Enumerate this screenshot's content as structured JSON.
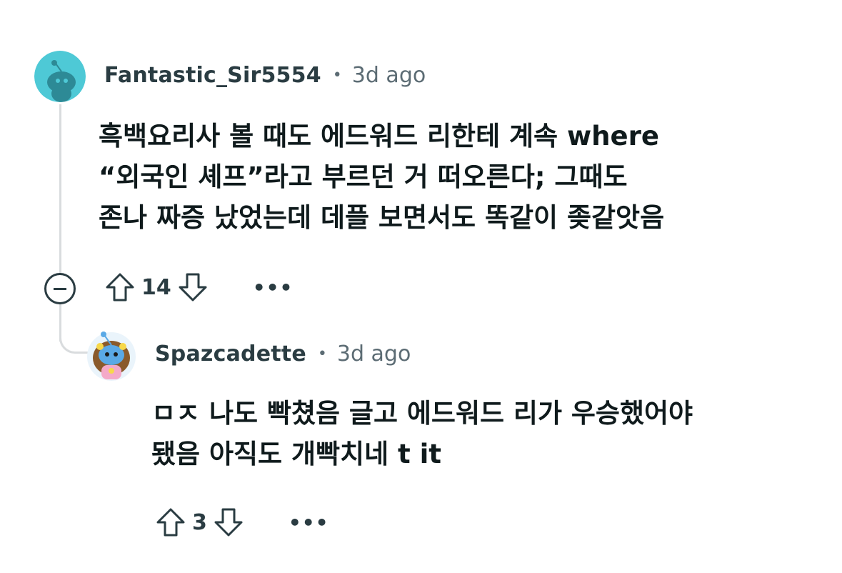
{
  "comments": [
    {
      "author": "Fantastic_Sir5554",
      "separator": "•",
      "time": "3d ago",
      "lines": [
        "흑백요리사 볼 때도 에드워드 리한테 계속 where",
        "“외국인 셰프”라고 부르던 거 떠오른다; 그때도",
        "존나 짜증 났었는데 데플 보면서도 똑같이 좆같앗음"
      ],
      "score": "14",
      "avatar_color": "#4ec9d6"
    },
    {
      "author": "Spazcadette",
      "separator": "•",
      "time": "3d ago",
      "lines": [
        "ㅁㅈ 나도 빡쳤음 글고 에드워드 리가 우승했어야",
        "됐음 아직도 개빡치네 t it"
      ],
      "score": "3",
      "avatar_color": "#5aa9e6"
    }
  ],
  "more_label": "•••"
}
